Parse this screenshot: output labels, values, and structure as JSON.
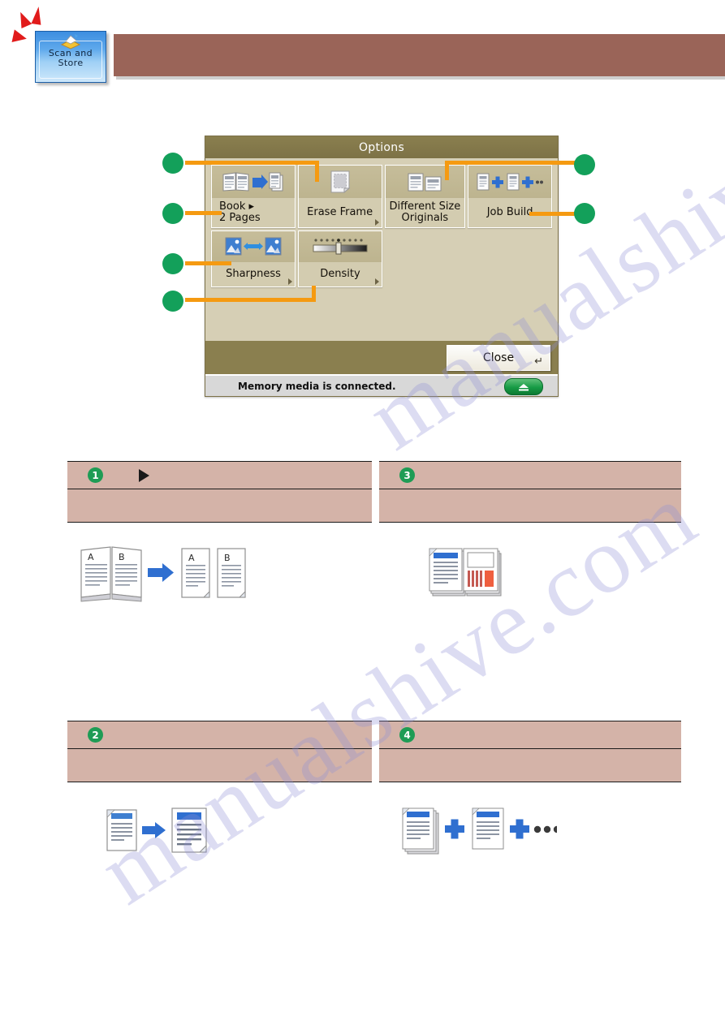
{
  "app_icon": {
    "label_line1": "Scan  and",
    "label_line2": "Store",
    "name": "scan-and-store"
  },
  "panel": {
    "title": "Options",
    "buttons": [
      {
        "id": "book-2-pages",
        "label_line1": "Book ▸",
        "label_line2": "2 Pages",
        "icon": "book-to-two-pages-icon",
        "has_corner_arrow": false
      },
      {
        "id": "erase-frame",
        "label_line1": "Erase Frame",
        "label_line2": "",
        "icon": "erase-frame-icon",
        "has_corner_arrow": true
      },
      {
        "id": "different-size-originals",
        "label_line1": "Different Size",
        "label_line2": "Originals",
        "icon": "different-size-originals-icon",
        "has_corner_arrow": false
      },
      {
        "id": "job-build",
        "label_line1": "Job Build",
        "label_line2": "",
        "icon": "job-build-icon",
        "has_corner_arrow": false
      },
      {
        "id": "sharpness",
        "label_line1": "Sharpness",
        "label_line2": "",
        "icon": "sharpness-icon",
        "has_corner_arrow": true
      },
      {
        "id": "density",
        "label_line1": "Density",
        "label_line2": "",
        "icon": "density-slider-icon",
        "has_corner_arrow": true
      }
    ],
    "close_label": "Close",
    "close_return_glyph": "↵",
    "status_text": "Memory media is connected.",
    "eject_icon": "eject-icon"
  },
  "callouts": {
    "dot_color": "#13a05a",
    "lead_color": "#f59a11",
    "markers": [
      {
        "id": "callout-left-1",
        "target": "erase-frame"
      },
      {
        "id": "callout-left-2",
        "target": "book-2-pages"
      },
      {
        "id": "callout-left-3",
        "target": "sharpness"
      },
      {
        "id": "callout-left-4",
        "target": "density"
      },
      {
        "id": "callout-right-1",
        "target": "different-size-originals"
      },
      {
        "id": "callout-right-2",
        "target": "job-build"
      }
    ]
  },
  "descriptions": [
    {
      "number": "1",
      "has_arrow": true,
      "illustration": "book-to-two-pages-illustration",
      "page_labels": [
        "A",
        "B"
      ]
    },
    {
      "number": "3",
      "has_arrow": false,
      "illustration": "different-size-originals-illustration",
      "page_labels": []
    },
    {
      "number": "2",
      "has_arrow": false,
      "illustration": "sharpness-illustration",
      "page_labels": []
    },
    {
      "number": "4",
      "has_arrow": false,
      "illustration": "job-build-illustration",
      "page_labels": []
    }
  ],
  "watermark": {
    "text": "manualshive.com"
  },
  "colors": {
    "header_bar": "#9a6458",
    "panel_bg": "#d6cfb5",
    "panel_title_bg": "#8a7f4f",
    "desc_row_bg": "#d4b3a8",
    "badge_green": "#1e9c55",
    "accent_orange": "#f59a11",
    "doc_blue": "#2f6fd0"
  }
}
